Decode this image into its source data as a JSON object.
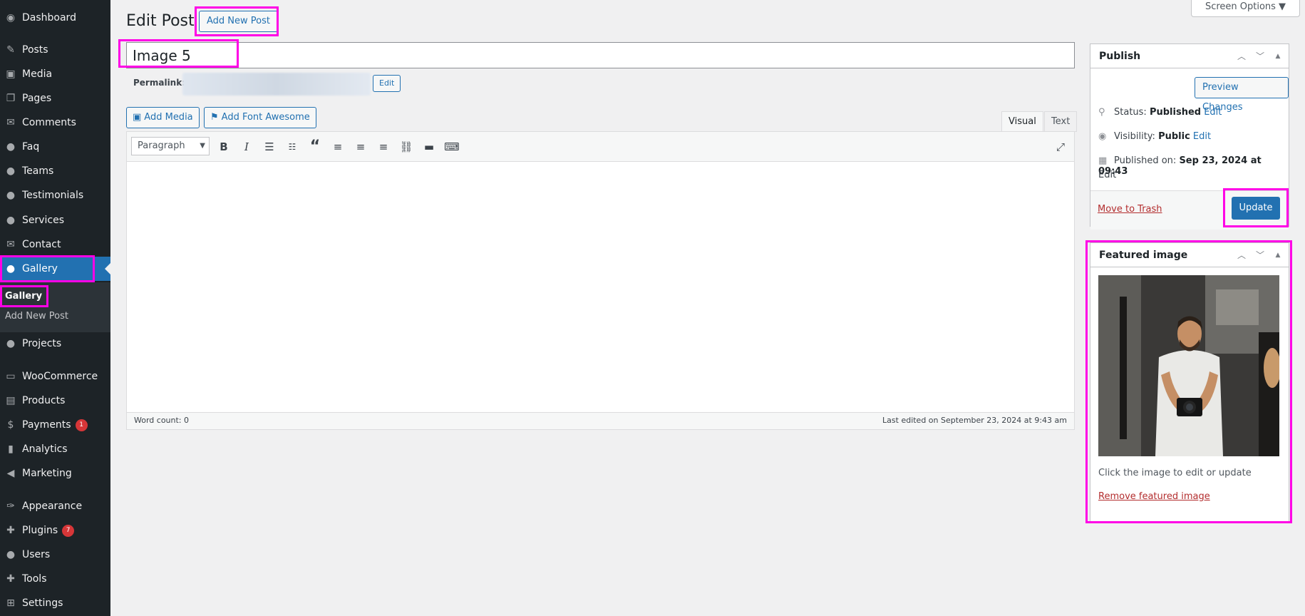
{
  "sidebar": {
    "items": [
      {
        "label": "Dashboard",
        "icon": "dashboard-icon",
        "glyph": "◉"
      },
      {
        "label": "Posts",
        "icon": "pin-icon",
        "glyph": "✎"
      },
      {
        "label": "Media",
        "icon": "media-icon",
        "glyph": "▣"
      },
      {
        "label": "Pages",
        "icon": "pages-icon",
        "glyph": "❐"
      },
      {
        "label": "Comments",
        "icon": "comment-icon",
        "glyph": "✉"
      },
      {
        "label": "Faq",
        "icon": "user-icon",
        "glyph": "●"
      },
      {
        "label": "Teams",
        "icon": "user-icon",
        "glyph": "●"
      },
      {
        "label": "Testimonials",
        "icon": "user-icon",
        "glyph": "●"
      },
      {
        "label": "Services",
        "icon": "user-icon",
        "glyph": "●"
      },
      {
        "label": "Contact",
        "icon": "mail-icon",
        "glyph": "✉"
      },
      {
        "label": "Gallery",
        "icon": "user-icon",
        "glyph": "●"
      },
      {
        "label": "Projects",
        "icon": "user-icon",
        "glyph": "●"
      },
      {
        "label": "WooCommerce",
        "icon": "woo-icon",
        "glyph": "▭"
      },
      {
        "label": "Products",
        "icon": "archive-icon",
        "glyph": "▤"
      },
      {
        "label": "Payments",
        "icon": "payments-icon",
        "glyph": "$",
        "badge": "1"
      },
      {
        "label": "Analytics",
        "icon": "chart-icon",
        "glyph": "▮"
      },
      {
        "label": "Marketing",
        "icon": "megaphone-icon",
        "glyph": "◀"
      },
      {
        "label": "Appearance",
        "icon": "brush-icon",
        "glyph": "✑"
      },
      {
        "label": "Plugins",
        "icon": "plugin-icon",
        "glyph": "✚",
        "badge": "7"
      },
      {
        "label": "Users",
        "icon": "users-icon",
        "glyph": "●"
      },
      {
        "label": "Tools",
        "icon": "wrench-icon",
        "glyph": "✚"
      },
      {
        "label": "Settings",
        "icon": "settings-icon",
        "glyph": "⊞"
      }
    ],
    "submenu": {
      "current": "Gallery",
      "add_new": "Add New Post"
    }
  },
  "header": {
    "title": "Edit Post",
    "add_new": "Add New Post",
    "screen_options": "Screen Options ▼"
  },
  "post": {
    "title": "Image 5",
    "permalink_label": "Permalink:",
    "permalink_edit": "Edit"
  },
  "editor": {
    "add_media": "Add Media",
    "add_font_awesome": "Add Font Awesome",
    "tab_visual": "Visual",
    "tab_text": "Text",
    "format": "Paragraph",
    "word_count": "Word count: 0",
    "last_edited": "Last edited on September 23, 2024 at 9:43 am"
  },
  "publish": {
    "title": "Publish",
    "preview": "Preview Changes",
    "status_label": "Status:",
    "status_value": "Published",
    "visibility_label": "Visibility:",
    "visibility_value": "Public",
    "published_label": "Published on:",
    "published_value": "Sep 23, 2024 at 09:43",
    "edit": "Edit",
    "trash": "Move to Trash",
    "update": "Update"
  },
  "featured": {
    "title": "Featured image",
    "caption": "Click the image to edit or update",
    "remove": "Remove featured image"
  },
  "colors": {
    "accent": "#2271b1",
    "sidebar_bg": "#1d2327",
    "highlight": "#ff00e6",
    "danger": "#b32d2e"
  }
}
